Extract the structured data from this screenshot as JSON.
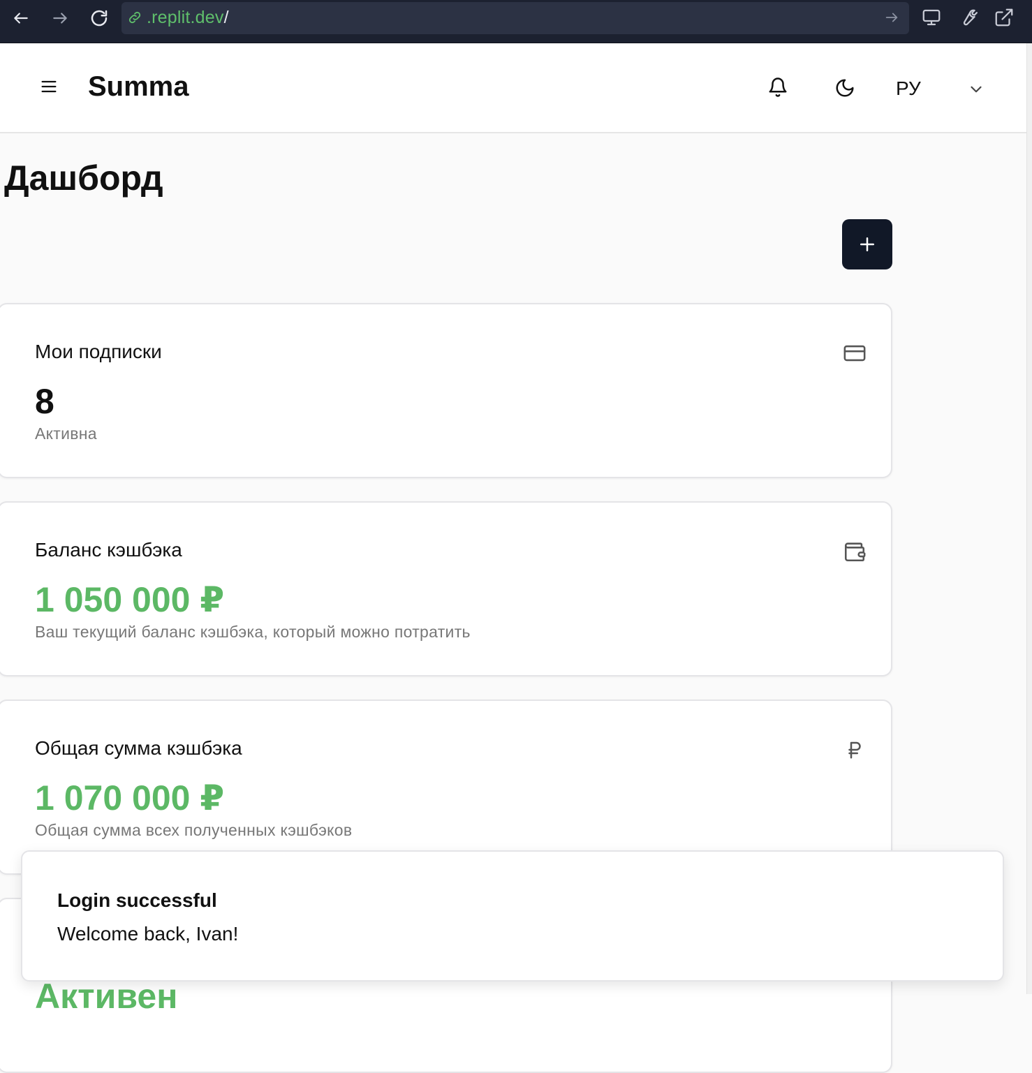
{
  "browser": {
    "url_host": ".replit.dev",
    "url_path": "/",
    "icons": [
      "back-arrow-icon",
      "forward-arrow-icon",
      "reload-icon",
      "link-icon",
      "go-arrow-icon",
      "monitor-icon",
      "wrench-icon",
      "external-link-icon"
    ]
  },
  "header": {
    "brand": "Summa",
    "language": "РУ",
    "icons": [
      "hamburger-menu-icon",
      "bell-icon",
      "moon-icon",
      "chevron-down-icon"
    ]
  },
  "page": {
    "title": "Дашборд",
    "add_button_icon": "plus-icon"
  },
  "cards": [
    {
      "title": "Мои подписки",
      "value": "8",
      "subtitle": "Активна",
      "icon": "credit-card-icon"
    },
    {
      "title": "Баланс кэшбэка",
      "value": "1 050 000 ₽",
      "subtitle": "Ваш текущий баланс кэшбэка, который можно потратить",
      "icon": "wallet-icon"
    },
    {
      "title": "Общая сумма кэшбэка",
      "value": "1 070 000 ₽",
      "subtitle": "Общая сумма всех полученных кэшбэков",
      "icon": "ruble-icon"
    },
    {
      "value": "Активен"
    }
  ],
  "toast": {
    "title": "Login successful",
    "description": "Welcome back, Ivan!"
  },
  "colors": {
    "accent_green": "#5cb865",
    "dark_button": "#111827",
    "browser_bar": "#1c2130"
  }
}
